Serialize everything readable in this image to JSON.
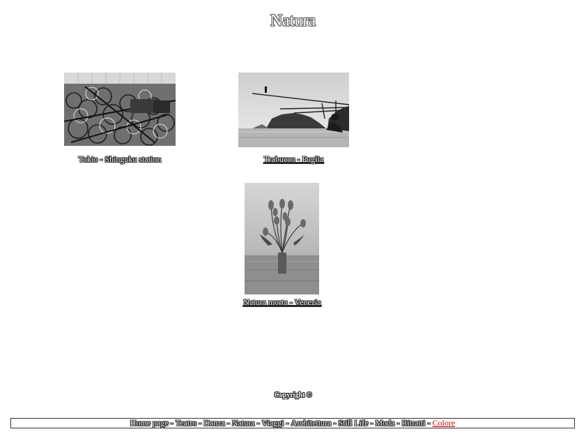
{
  "page": {
    "title": "Natura"
  },
  "gallery": {
    "items": [
      {
        "caption": "Tokio - Shinguku station",
        "image": "bicycles-photo",
        "linked": false
      },
      {
        "caption": "Trabucco - Puglia",
        "image": "trabucco-photo",
        "linked": true
      },
      {
        "caption": "Natura morta - Venezia",
        "image": "tulips-photo",
        "linked": true
      }
    ]
  },
  "copyright": {
    "text": "Copyright ©"
  },
  "footer": {
    "separator": "-",
    "links": [
      {
        "label": "Home page"
      },
      {
        "label": "Teatro"
      },
      {
        "label": "Danza"
      },
      {
        "label": "Natura"
      },
      {
        "label": "Viaggi"
      },
      {
        "label": "Architettura"
      },
      {
        "label": "Still Life"
      },
      {
        "label": "Moda"
      },
      {
        "label": "Ritratti"
      },
      {
        "label": "Colore",
        "active": true
      }
    ],
    "active_color": "#cc0000"
  }
}
